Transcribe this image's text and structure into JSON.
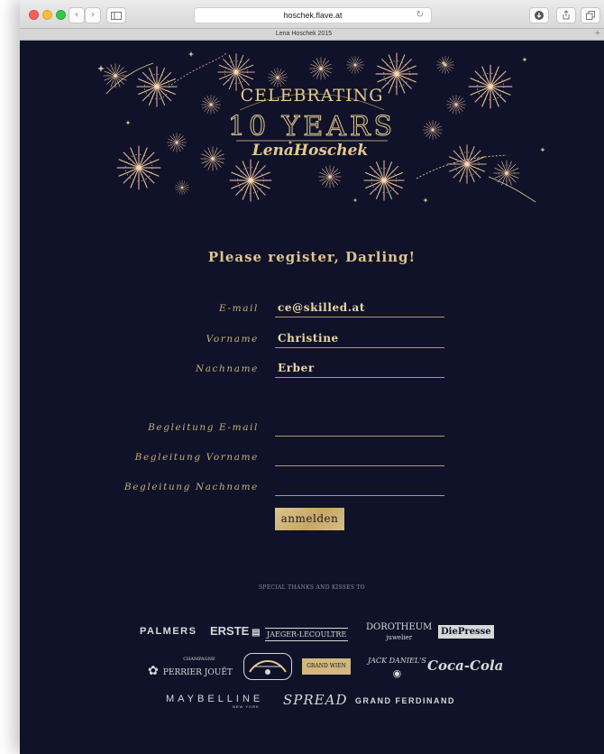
{
  "browser": {
    "url": "hoschek.flave.at",
    "tab_title": "Lena Hoschek 2015"
  },
  "banner": {
    "line1": "CELEBRATING",
    "line2": "10 YEARS",
    "line3": "LenaHoschek"
  },
  "form": {
    "heading": "Please register, Darling!",
    "fields": [
      {
        "label": "E-mail",
        "value": "ce@skilled.at"
      },
      {
        "label": "Vorname",
        "value": "Christine"
      },
      {
        "label": "Nachname",
        "value": "Erber"
      },
      {
        "label": "Begleitung E-mail",
        "value": ""
      },
      {
        "label": "Begleitung Vorname",
        "value": ""
      },
      {
        "label": "Begleitung Nachname",
        "value": ""
      }
    ],
    "submit_label": "anmelden"
  },
  "sponsors": {
    "heading": "SPECIAL THANKS AND KISSES TO",
    "palmers": "PALMERS",
    "erste": "ERSTE",
    "jaeger": "JAEGER-LECOULTRE",
    "dorotheum": "DOROTHEUM",
    "dorotheum_sub": "juwelier",
    "diepresse": "DiePresse",
    "perrier_top": "CHAMPAGNE",
    "perrier": "PERRIER JOUËT",
    "grand_wien": "GRAND WIEN",
    "jackdaniels": "JACK DANIEL'S",
    "cocacola": "Coca-Cola",
    "maybelline": "MAYBELLINE",
    "maybelline_sub": "NEW YORK",
    "spread": "SPREAD",
    "grandferdinand": "GRAND FERDINAND"
  },
  "colors": {
    "background": "#0f1228",
    "gold": "#e0c48a",
    "button": "#c7a765"
  }
}
